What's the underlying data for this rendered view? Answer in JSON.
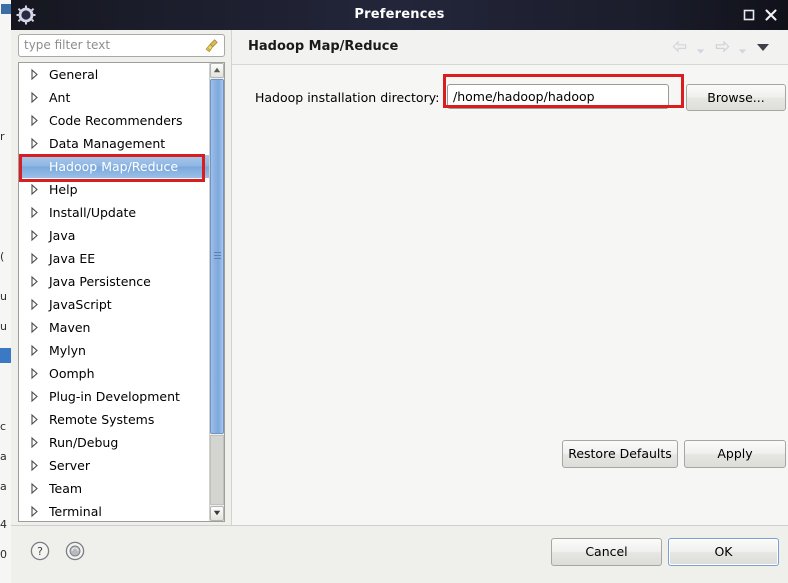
{
  "window": {
    "title": "Preferences",
    "icon": "gear-icon",
    "controls": {
      "maximize": "maximize-icon",
      "close": "close-icon"
    }
  },
  "filter": {
    "placeholder": "type filter text",
    "value": "",
    "clear_icon": "broom-clear-icon"
  },
  "tree": {
    "items": [
      {
        "label": "General",
        "expandable": true,
        "selected": false
      },
      {
        "label": "Ant",
        "expandable": true,
        "selected": false
      },
      {
        "label": "Code Recommenders",
        "expandable": true,
        "selected": false
      },
      {
        "label": "Data Management",
        "expandable": true,
        "selected": false
      },
      {
        "label": "Hadoop Map/Reduce",
        "expandable": false,
        "selected": true
      },
      {
        "label": "Help",
        "expandable": true,
        "selected": false
      },
      {
        "label": "Install/Update",
        "expandable": true,
        "selected": false
      },
      {
        "label": "Java",
        "expandable": true,
        "selected": false
      },
      {
        "label": "Java EE",
        "expandable": true,
        "selected": false
      },
      {
        "label": "Java Persistence",
        "expandable": true,
        "selected": false
      },
      {
        "label": "JavaScript",
        "expandable": true,
        "selected": false
      },
      {
        "label": "Maven",
        "expandable": true,
        "selected": false
      },
      {
        "label": "Mylyn",
        "expandable": true,
        "selected": false
      },
      {
        "label": "Oomph",
        "expandable": true,
        "selected": false
      },
      {
        "label": "Plug-in Development",
        "expandable": true,
        "selected": false
      },
      {
        "label": "Remote Systems",
        "expandable": true,
        "selected": false
      },
      {
        "label": "Run/Debug",
        "expandable": true,
        "selected": false
      },
      {
        "label": "Server",
        "expandable": true,
        "selected": false
      },
      {
        "label": "Team",
        "expandable": true,
        "selected": false
      },
      {
        "label": "Terminal",
        "expandable": true,
        "selected": false
      }
    ],
    "scrollbar": {
      "up_icon": "chevron-up-icon",
      "down_icon": "chevron-down-icon"
    }
  },
  "page": {
    "title": "Hadoop Map/Reduce",
    "nav": {
      "back_icon": "arrow-back-icon",
      "back_dropdown_icon": "chevron-down-icon",
      "forward_icon": "arrow-forward-icon",
      "forward_dropdown_icon": "chevron-down-icon",
      "menu_icon": "view-menu-icon"
    },
    "field": {
      "label": "Hadoop installation directory:",
      "value": "/home/hadoop/hadoop",
      "placeholder": ""
    },
    "browse_label": "Browse...",
    "restore_defaults_label": "Restore Defaults",
    "apply_label": "Apply"
  },
  "footer": {
    "help_icon": "help-question-icon",
    "about_icon": "about-circle-icon",
    "cancel_label": "Cancel",
    "ok_label": "OK"
  },
  "annotations": [
    {
      "name": "tree-selection-highlight",
      "color": "#d81e1e"
    },
    {
      "name": "directory-field-highlight",
      "color": "#d81e1e"
    }
  ],
  "colors": {
    "titlebar": "#23253a",
    "selection": "#8fb6e2",
    "annotation": "#d81e1e",
    "dialog_bg": "#efefeb",
    "panel_bg": "#f6f6f4"
  }
}
